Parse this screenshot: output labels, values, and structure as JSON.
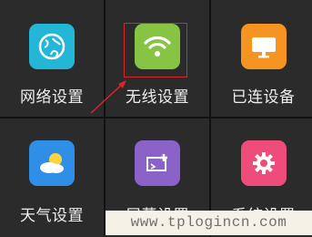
{
  "tiles": [
    {
      "label": "网络设置",
      "icon": "globe-icon",
      "color": "#23b6d6"
    },
    {
      "label": "无线设置",
      "icon": "wifi-icon",
      "color": "#87c443"
    },
    {
      "label": "已连设备",
      "icon": "monitor-icon",
      "color": "#f79320"
    },
    {
      "label": "天气设置",
      "icon": "weather-icon",
      "color": "#2f8ee6"
    },
    {
      "label": "屏幕设置",
      "icon": "screen-edit-icon",
      "color": "#8b62c8"
    },
    {
      "label": "系统设置",
      "icon": "gear-icon",
      "color": "#ee4d7b"
    }
  ],
  "annotation": {
    "highlight_color": "#d8262b"
  },
  "watermark": "www.tplogincn.com"
}
